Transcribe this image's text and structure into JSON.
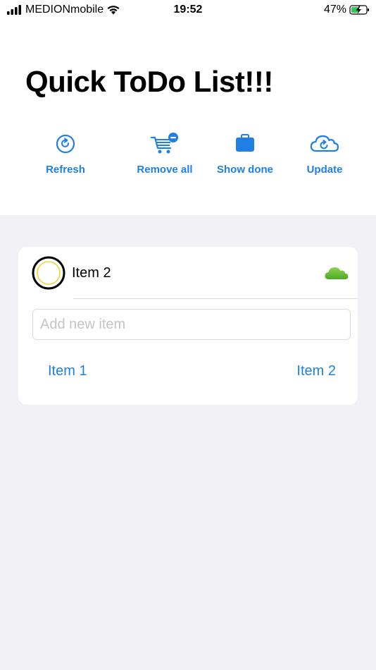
{
  "status_bar": {
    "carrier": "MEDIONmobile",
    "time": "19:52",
    "battery_percent": "47%"
  },
  "title": "Quick ToDo List!!!",
  "toolbar": {
    "refresh_label": "Refresh",
    "remove_all_label": "Remove all",
    "show_done_label": "Show done",
    "update_label": "Update"
  },
  "todo_items": [
    {
      "label": "Item 2",
      "icon": "cloud-icon"
    }
  ],
  "add_item": {
    "placeholder": "Add new item",
    "value": ""
  },
  "links": [
    "Item 1",
    "Item 2"
  ],
  "colors": {
    "accent": "#1f7fe3",
    "background": "#f0f0f5",
    "card": "#ffffff",
    "cloud": "#6cc13a",
    "circle_ring": "#f5d23a"
  }
}
